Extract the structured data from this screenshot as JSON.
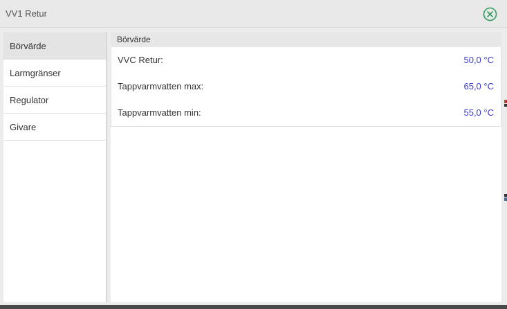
{
  "window": {
    "title": "VV1 Retur",
    "close_icon": "close-circle-icon",
    "accent_color": "#2e9e5b"
  },
  "sidebar": {
    "items": [
      {
        "label": "Börvärde",
        "active": true
      },
      {
        "label": "Larmgränser",
        "active": false
      },
      {
        "label": "Regulator",
        "active": false
      },
      {
        "label": "Givare",
        "active": false
      }
    ]
  },
  "main": {
    "section_title": "Börvärde",
    "value_color": "#3a3acc",
    "rows": [
      {
        "label": "VVC Retur:",
        "value": "50,0 °C"
      },
      {
        "label": "Tappvarmvatten max:",
        "value": "65,0 °C"
      },
      {
        "label": "Tappvarmvatten min:",
        "value": "55,0 °C"
      }
    ]
  }
}
